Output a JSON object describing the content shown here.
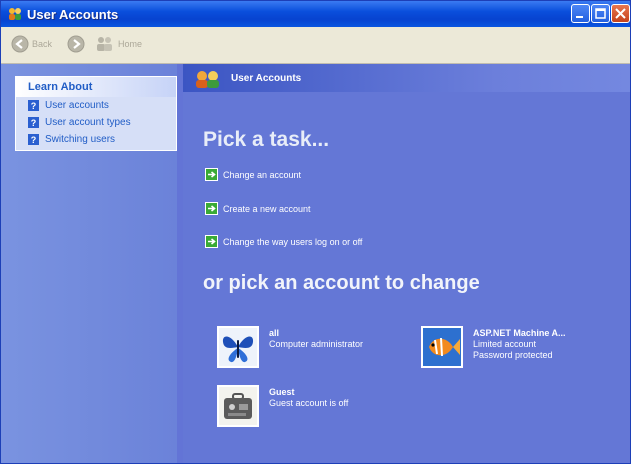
{
  "window": {
    "title": "User Accounts",
    "controls": [
      "minimize",
      "maximize",
      "close"
    ]
  },
  "toolbar": {
    "back_label": "Back",
    "forward_label": "",
    "home_label": "Home"
  },
  "sidebar": {
    "heading": "Learn About",
    "items": [
      {
        "label": "User accounts",
        "icon": "help-icon"
      },
      {
        "label": "User account types",
        "icon": "help-icon"
      },
      {
        "label": "Switching users",
        "icon": "help-icon"
      }
    ]
  },
  "main": {
    "header_title": "User Accounts",
    "pick_task_heading": "Pick a task...",
    "tasks": [
      {
        "label": "Change an account",
        "icon": "green-arrow-icon"
      },
      {
        "label": "Create a new account",
        "icon": "green-arrow-icon"
      },
      {
        "label": "Change the way users log on or off",
        "icon": "green-arrow-icon"
      }
    ],
    "pick_account_heading": "or pick an account to change",
    "accounts": [
      {
        "name": "all",
        "lines": [
          "Computer administrator"
        ],
        "picture": "butterfly-icon"
      },
      {
        "name": "ASP.NET Machine A...",
        "lines": [
          "Limited account",
          "Password protected"
        ],
        "picture": "fish-icon"
      },
      {
        "name": "Guest",
        "lines": [
          "Guest account is off"
        ],
        "picture": "briefcase-icon"
      }
    ]
  },
  "colors": {
    "title_bar": "#0a4fdc",
    "main_background": "#6477d6",
    "sidebar_link": "#215dc6",
    "task_arrow": "#3aaa35"
  }
}
